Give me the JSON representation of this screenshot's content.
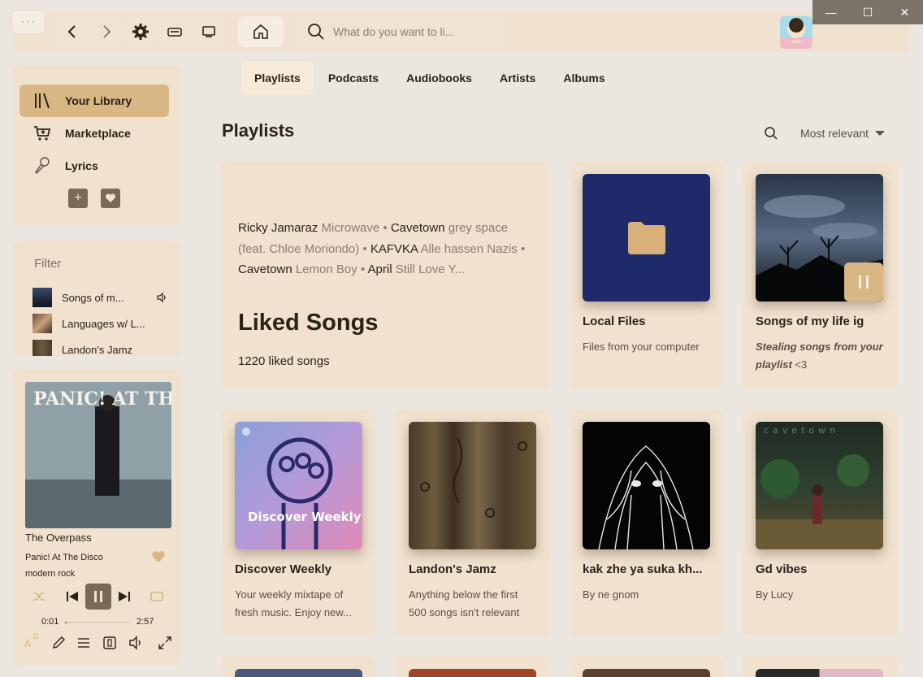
{
  "header": {
    "menu_label": "···",
    "search_placeholder": "What do you want to li..."
  },
  "window_controls": {
    "minimize": "—",
    "maximize": "☐",
    "close": "✕"
  },
  "sidebar": {
    "nav_items": [
      {
        "label": "Your Library",
        "icon": "library-icon"
      },
      {
        "label": "Marketplace",
        "icon": "cart-icon"
      },
      {
        "label": "Lyrics",
        "icon": "microphone-icon"
      }
    ],
    "add_label": "+",
    "filter_label": "Filter",
    "mini_items": [
      {
        "label": "Songs of m..."
      },
      {
        "label": "Languages w/ L..."
      },
      {
        "label": "Landon's Jamz"
      }
    ]
  },
  "player": {
    "cover_text": "PANIC! AT THE DISCO PRAY FOR THE WICKED",
    "title": "The Overpass",
    "artist": "Panic! At The Disco",
    "genre": "modern rock",
    "elapsed": "0:01",
    "duration": "2:57",
    "progress": 0.006,
    "lyrics_badge": "D"
  },
  "tabs": [
    "Playlists",
    "Podcasts",
    "Audiobooks",
    "Artists",
    "Albums"
  ],
  "section": {
    "title": "Playlists",
    "sort_label": "Most relevant"
  },
  "liked": {
    "preview": [
      {
        "artist": "Ricky Jamaraz",
        "song": "Microwave"
      },
      {
        "artist": "Cavetown",
        "song": "grey space (feat. Chloe Moriondo)"
      },
      {
        "artist": "KAFVKA",
        "song": "Alle hassen Nazis"
      },
      {
        "artist": "Cavetown",
        "song": "Lemon Boy"
      },
      {
        "artist": "April",
        "song": "Still Love Y..."
      }
    ],
    "separator": "•",
    "title": "Liked Songs",
    "count": "1220 liked songs"
  },
  "cards": [
    {
      "title": "Local Files",
      "sub": "Files from your computer"
    },
    {
      "title": "Songs of my life ig",
      "sub_italic": "Stealing songs from your playlist",
      "sub_tail": " <3"
    },
    {
      "title": "Discover Weekly",
      "sub": "Your weekly mixtape of fresh music. Enjoy new...",
      "art_text": "Discover Weekly"
    },
    {
      "title": "Landon's Jamz",
      "sub": "Anything below the first 500 songs isn't relevant"
    },
    {
      "title": "kak zhe ya suka kh...",
      "sub": "By ne gnom"
    },
    {
      "title": "Gd vibes",
      "sub": "By Lucy",
      "art_text": "cavetown"
    }
  ],
  "colors": {
    "background": "#ece6e1",
    "panel": "#f0e2cf",
    "accent": "#d8b784",
    "dark_button": "#7a6a55",
    "local_files_art": "#1e2a6a",
    "folder": "#d9b07a"
  }
}
